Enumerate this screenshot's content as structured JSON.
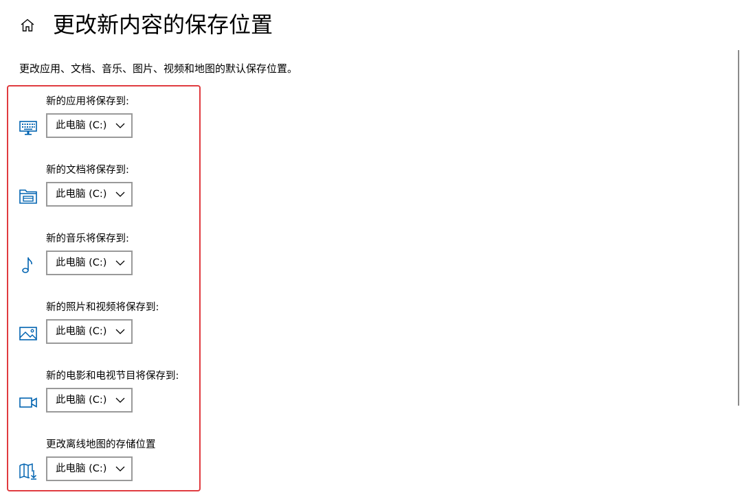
{
  "page": {
    "title": "更改新内容的保存位置",
    "description": "更改应用、文档、音乐、图片、视频和地图的默认保存位置。"
  },
  "colors": {
    "accent": "#0063b1",
    "highlight_border": "#e03a3e",
    "dropdown_border": "#999999"
  },
  "settings": [
    {
      "label": "新的应用将保存到:",
      "value": "此电脑 (C:)",
      "icon": "app-keyboard-icon"
    },
    {
      "label": "新的文档将保存到:",
      "value": "此电脑 (C:)",
      "icon": "documents-folder-icon"
    },
    {
      "label": "新的音乐将保存到:",
      "value": "此电脑 (C:)",
      "icon": "music-note-icon"
    },
    {
      "label": "新的照片和视频将保存到:",
      "value": "此电脑 (C:)",
      "icon": "picture-icon"
    },
    {
      "label": "新的电影和电视节目将保存到:",
      "value": "此电脑 (C:)",
      "icon": "video-camera-icon"
    },
    {
      "label": "更改离线地图的存储位置",
      "value": "此电脑 (C:)",
      "icon": "map-download-icon"
    }
  ]
}
